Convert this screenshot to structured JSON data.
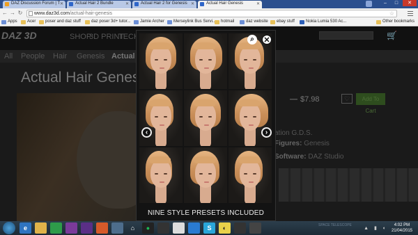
{
  "browser": {
    "tabs": [
      {
        "label": "DAZ Discussion Forum | T",
        "favicon": "daz-icon"
      },
      {
        "label": "Actual Hair 2 Bundle",
        "favicon": "daz-icon"
      },
      {
        "label": "Actual Hair 2 for Genesis",
        "favicon": "daz-icon"
      },
      {
        "label": "Actual Hair Genesis",
        "favicon": "daz-icon",
        "active": true
      }
    ],
    "url": {
      "domain": "www.daz3d.com",
      "path": "/actual-hair-genesis"
    },
    "bookmarks": [
      "Apps",
      "Acer",
      "poser and daz stuff",
      "daz poser 3d+ tutor...",
      "Jamie Archer",
      "Merseylink Bus Servi...",
      "hotmail",
      "daz website",
      "ebay stuff",
      "Nokia Lumia 530 Ac...",
      "Other bookmarks"
    ]
  },
  "site": {
    "logo": "DAZ 3D",
    "nav": [
      "SHOP",
      "3D PRINT",
      "TECHN"
    ],
    "subnav": [
      "All",
      "People",
      "Hair",
      "Genesis",
      "Actual"
    ],
    "product_title": "Actual Hair Genesis",
    "price_old": "—",
    "price": "$7.98",
    "wishlist_icon": "heart-icon",
    "add_label": "Add To Cart",
    "artist": "Genesis",
    "figures_label": "Figures:",
    "figures_value": "Genesis",
    "software_label": "Software:",
    "software_value": "DAZ Studio",
    "vendor_line": "ation G.D.S."
  },
  "lightbox": {
    "caption": "NINE STYLE PRESETS INCLUDED",
    "zoom_icon": "zoom-icon",
    "close_icon": "close-icon",
    "prev_icon": "chevron-left-icon",
    "next_icon": "chevron-right-icon"
  },
  "taskbar": {
    "time": "4:02 PM",
    "date": "21/04/2015",
    "wallpaper_text": "SPACE TELESCOPE"
  }
}
